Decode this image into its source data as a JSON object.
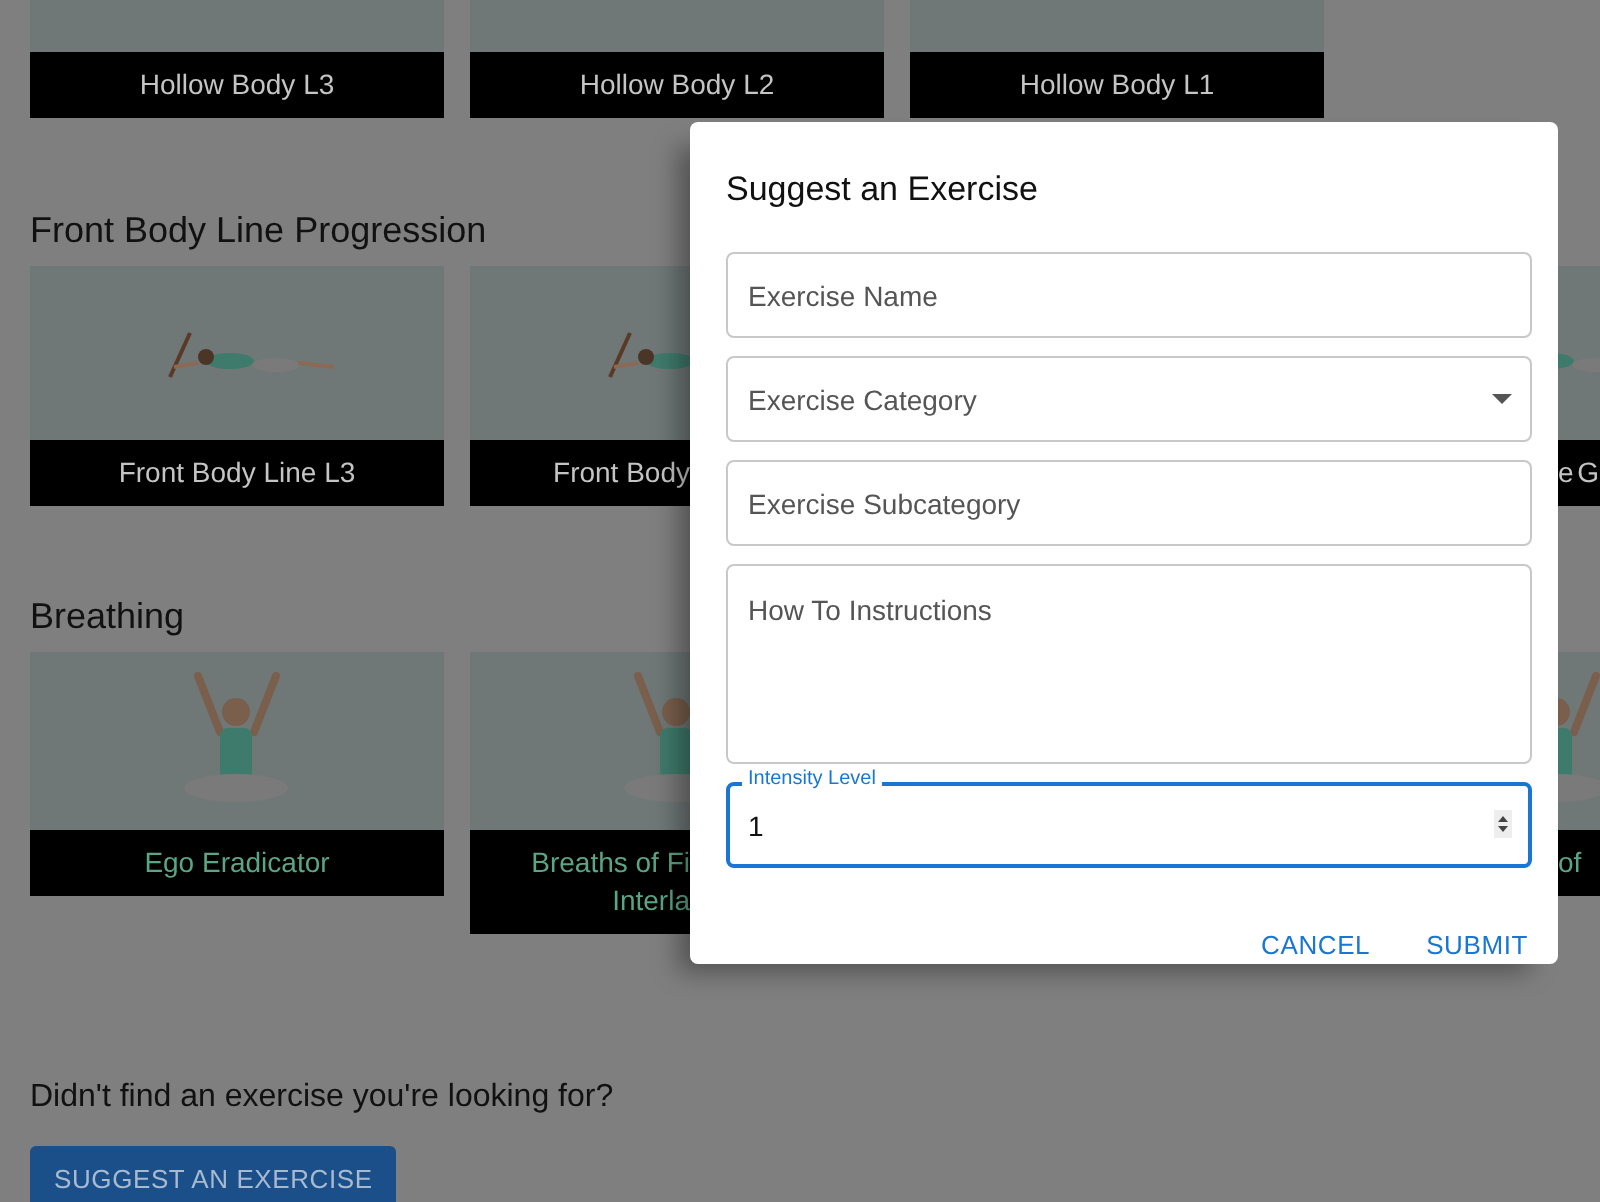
{
  "sections": [
    {
      "cards": [
        {
          "kind": "blank",
          "label": "Hollow Body L3",
          "color": "#c4c4c4"
        },
        {
          "kind": "blank",
          "label": "Hollow Body L2",
          "color": "#c4c4c4"
        },
        {
          "kind": "blank",
          "label": "Hollow Body L1",
          "color": "#c4c4c4"
        }
      ]
    },
    {
      "title": "Front Body Line Progression",
      "cards": [
        {
          "kind": "lying",
          "label": "Front Body Line L3",
          "color": "#c4c4c4"
        },
        {
          "kind": "lying",
          "label": "Front Body",
          "color": "#c4c4c4"
        },
        {
          "kind": "lying",
          "label": "e G",
          "color": "#c4c4c4"
        }
      ]
    },
    {
      "title": "Breathing",
      "cards": [
        {
          "kind": "seated",
          "label": "Ego Eradicator",
          "color": "#5aa584"
        },
        {
          "kind": "seated",
          "label": "Breaths of Fi\nInterla",
          "color": "#5aa584"
        },
        {
          "kind": "seated",
          "label": "of",
          "color": "#5aa584"
        }
      ]
    }
  ],
  "prompt": "Didn't find an exercise you're looking for?",
  "suggest_button": "SUGGEST AN EXERCISE",
  "dialog": {
    "title": "Suggest an Exercise",
    "fields": [
      {
        "kind": "text",
        "placeholder": "Exercise Name"
      },
      {
        "kind": "select",
        "placeholder": "Exercise Category"
      },
      {
        "kind": "text",
        "placeholder": "Exercise Subcategory"
      },
      {
        "kind": "textarea",
        "placeholder": "How To Instructions"
      },
      {
        "kind": "number",
        "label": "Intensity Level",
        "value": "1",
        "focused": true
      }
    ],
    "buttons": [
      "CANCEL",
      "SUBMIT"
    ]
  }
}
